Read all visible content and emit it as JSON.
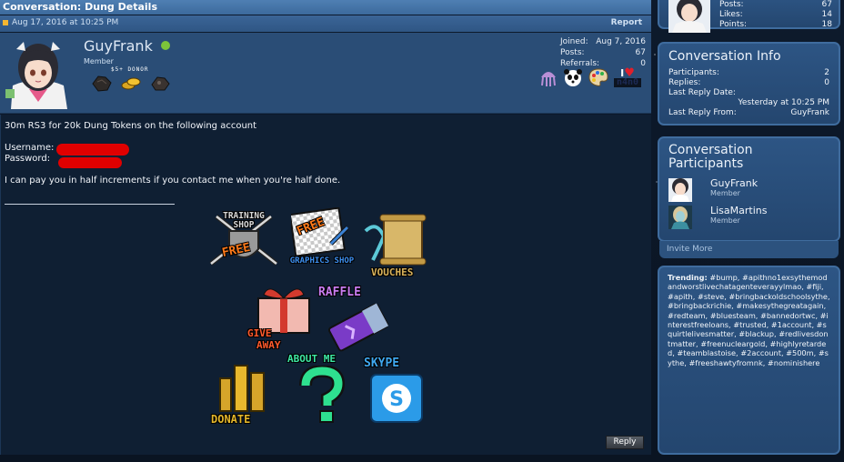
{
  "conversation": {
    "title": "Conversation: Dung Details",
    "date": "Aug 17, 2016 at 10:25 PM",
    "report_label": "Report",
    "reply_label": "Reply"
  },
  "author": {
    "name": "GuyFrank",
    "role": "Member",
    "donor_tag": "$5+ DONOR",
    "stats": [
      {
        "label": "Joined:",
        "value": "Aug 7, 2016"
      },
      {
        "label": "Posts:",
        "value": "67"
      },
      {
        "label": "Referrals:",
        "value": "0"
      }
    ],
    "love_tag_top": "I",
    "love_tag_bottom": "n4n0"
  },
  "post": {
    "line1": "30m RS3 for 20k Dung Tokens on the following account",
    "username_label": "Username:",
    "password_label": "Password:",
    "line3": "I can pay you in half increments if you contact me when you're half done."
  },
  "graphics": {
    "training_shop": "TRAINING SHOP",
    "free1": "FREE",
    "free2": "FREE",
    "graphics_shop": "GRAPHICS SHOP",
    "vouches": "VOUCHES",
    "raffle": "RAFFLE",
    "giveaway_1": "GIVE",
    "giveaway_2": "AWAY",
    "about_me": "ABOUT ME",
    "skype": "SKYPE",
    "donate": "DONATE"
  },
  "sidebar": {
    "mini_stats": [
      {
        "label": "Posts:",
        "value": "67"
      },
      {
        "label": "Likes:",
        "value": "14"
      },
      {
        "label": "Points:",
        "value": "18"
      }
    ],
    "info_title": "Conversation Info",
    "info": [
      {
        "label": "Participants:",
        "value": "2"
      },
      {
        "label": "Replies:",
        "value": "0"
      }
    ],
    "last_reply_date_label": "Last Reply Date:",
    "last_reply_date_value": "Yesterday at 10:25 PM",
    "last_reply_from_label": "Last Reply From:",
    "last_reply_from_value": "GuyFrank",
    "participants_title_1": "Conversation",
    "participants_title_2": "Participants",
    "participants": [
      {
        "name": "GuyFrank",
        "role": "Member"
      },
      {
        "name": "LisaMartins",
        "role": "Member"
      }
    ],
    "invite_label": "Invite More",
    "trending_label": "Trending:",
    "trending_text": "#bump, #apithno1exsythemodandworstlivechatagenteverayylmao, #fiji, #apith, #steve, #bringbackoldschoolsythe, #bringbackrichie, #makesythegreatagain, #redteam, #bluesteam, #bannedortwc, #interestfreeloans, #trusted, #1account, #squirtlelivesmatter, #blackup, #redlivesdontmatter, #freenucleargold, #highlyretarded, #teamblastoise, #2account, #500m, #sythe, #freeshawtyfromnk, #nominishere"
  },
  "colors": {
    "header_blue": "#4f7fb3",
    "panel_dark": "#0f1f33",
    "online_green": "#7cc43a",
    "redaction_red": "#e00000"
  }
}
